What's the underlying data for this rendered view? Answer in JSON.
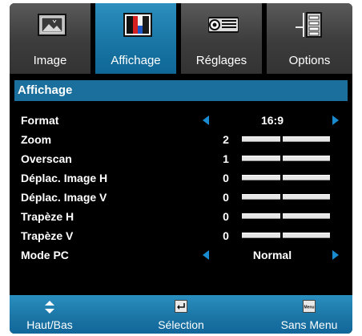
{
  "tabs": [
    {
      "label": "Image",
      "icon": "picture-icon",
      "active": false
    },
    {
      "label": "Affichage",
      "icon": "color-bars-icon",
      "active": true
    },
    {
      "label": "Réglages",
      "icon": "projector-icon",
      "active": false
    },
    {
      "label": "Options",
      "icon": "options-icon",
      "active": false
    }
  ],
  "panel": {
    "title": "Affichage",
    "rows": [
      {
        "name": "Format",
        "type": "choice",
        "value": "16:9"
      },
      {
        "name": "Zoom",
        "type": "slider",
        "value": "2",
        "level": 0.45
      },
      {
        "name": "Overscan",
        "type": "slider",
        "value": "1",
        "level": 0.45
      },
      {
        "name": "Déplac. Image H",
        "type": "slider",
        "value": "0",
        "level": 0.45
      },
      {
        "name": "Déplac. Image V",
        "type": "slider",
        "value": "0",
        "level": 0.45
      },
      {
        "name": "Trapèze H",
        "type": "slider",
        "value": "0",
        "level": 0.45
      },
      {
        "name": "Trapèze V",
        "type": "slider",
        "value": "0",
        "level": 0.45
      },
      {
        "name": "Mode PC",
        "type": "choice",
        "value": "Normal"
      }
    ]
  },
  "footer": {
    "updown_label": "Haut/Bas",
    "select_label": "Sélection",
    "menu_label": "Sans Menu",
    "menu_key_text": "Menu"
  },
  "colors": {
    "accent": "#1a6f9c",
    "tab_active": "#1874a3",
    "tab_inactive": "#474747",
    "arrow": "#1b8bd0"
  }
}
